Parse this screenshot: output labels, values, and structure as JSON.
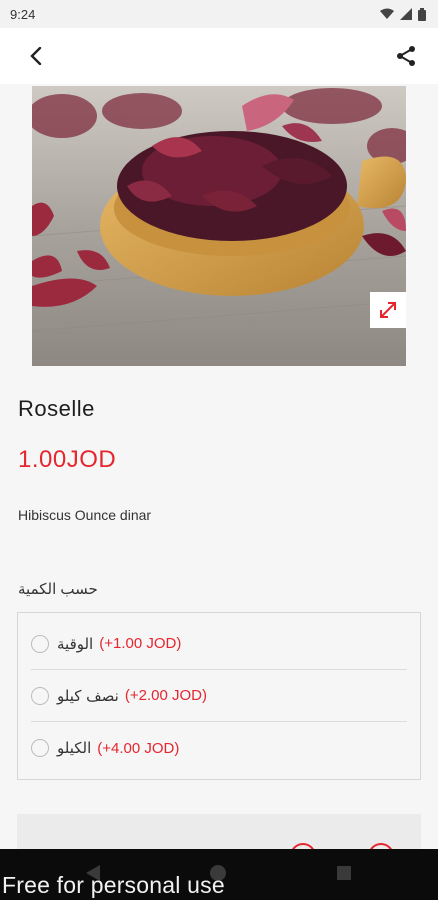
{
  "status_bar": {
    "time": "9:24",
    "icons": [
      "wifi-icon",
      "signal-icon",
      "battery-icon"
    ]
  },
  "app_bar": {
    "back_icon": "arrow-back-icon",
    "share_icon": "share-icon"
  },
  "product": {
    "image": "roselle-hibiscus-photo",
    "title": "Roselle",
    "price": "1.00JOD",
    "description": "Hibiscus Ounce dinar"
  },
  "options": {
    "section_label": "حسب الكمية",
    "items": [
      {
        "label": "الوقية",
        "price": "(+1.00 JOD)",
        "selected": false
      },
      {
        "label": "نصف كيلو",
        "price": "(+2.00 JOD)",
        "selected": false
      },
      {
        "label": "الكيلو",
        "price": "(+4.00 JOD)",
        "selected": false
      }
    ]
  },
  "watermark": "Free for personal use",
  "colors": {
    "accent": "#e4262f",
    "background": "#f6f6f6"
  }
}
